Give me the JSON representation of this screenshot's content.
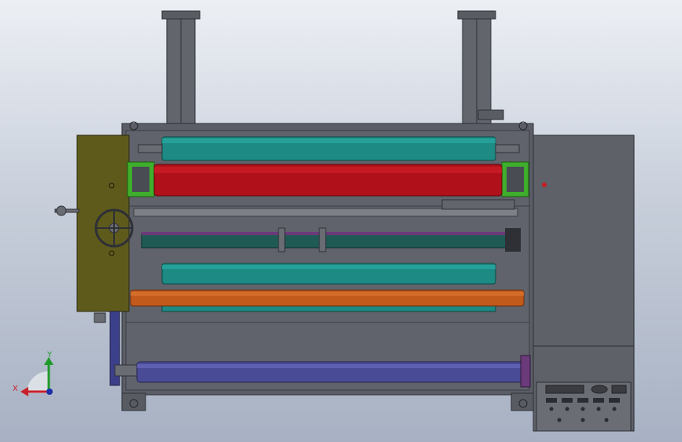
{
  "triad": {
    "x_label": "X",
    "y_label": "Y",
    "x_color": "#c8202a",
    "y_color": "#1f9a2a",
    "z_color": "#1b2fa8"
  },
  "colors": {
    "frame": "#5b5e66",
    "frame_dark": "#3a3c42",
    "side_panel": "#5f6169",
    "gearbox": "#5e5a1c",
    "roller_teal": "#1d8a84",
    "roller_red": "#b0101a",
    "roller_gray": "#7e8088",
    "roller_dark_teal": "#1f5a55",
    "roller_orange": "#c25a1c",
    "roller_purple": "#4a4b96",
    "bracket_green": "#3fae2c"
  }
}
